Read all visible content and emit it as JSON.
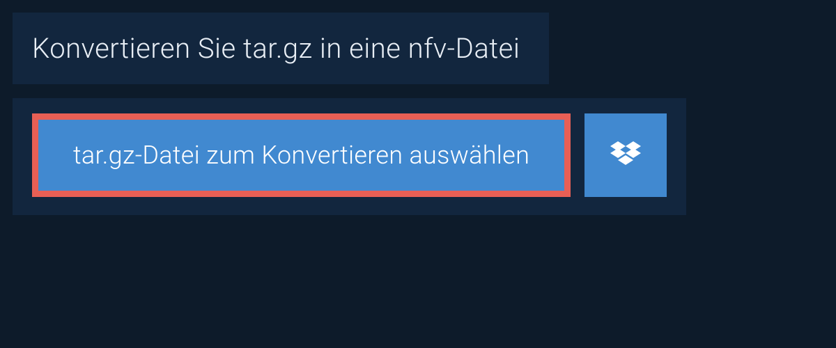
{
  "header": {
    "title": "Konvertieren Sie tar.gz in eine nfv-Datei"
  },
  "actions": {
    "select_file_label": "tar.gz-Datei zum Konvertieren auswählen"
  },
  "colors": {
    "page_bg": "#0d1b2a",
    "panel_bg": "#12263e",
    "button_bg": "#4189d0",
    "highlight_border": "#e85f55",
    "text_light": "#e8eef5",
    "text_white": "#ffffff"
  }
}
